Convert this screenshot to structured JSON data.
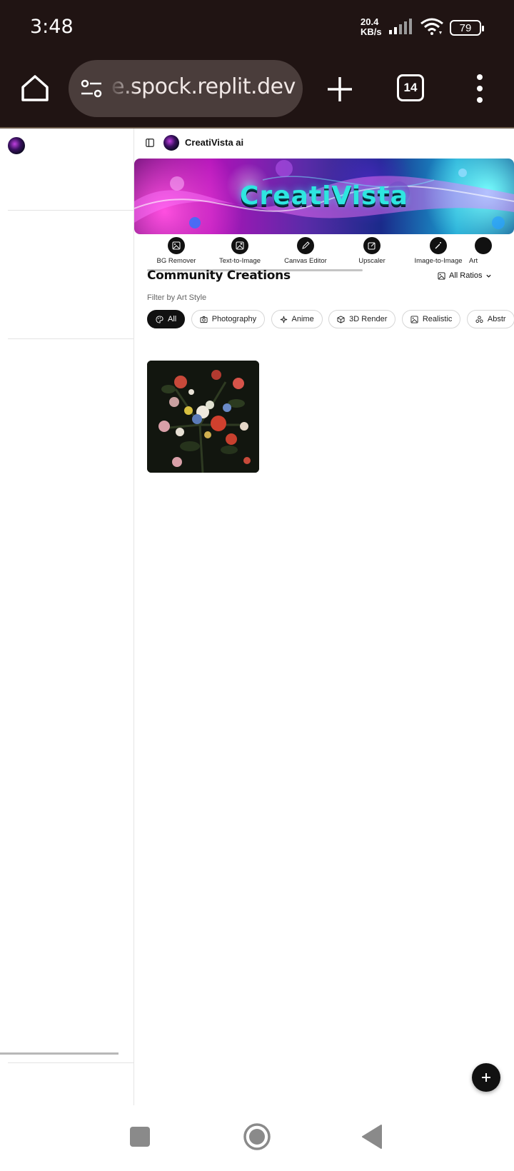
{
  "status_bar": {
    "time": "3:48",
    "net_speed_value": "20.4",
    "net_speed_unit": "KB/s",
    "battery": "79"
  },
  "browser": {
    "url": "e.spock.replit.dev",
    "tab_count": "14"
  },
  "app": {
    "brand_name": "CreatiVista ai",
    "banner_title": "CreatiVista"
  },
  "tools": [
    {
      "label": "BG Remover",
      "icon": "image-icon"
    },
    {
      "label": "Text-to-Image",
      "icon": "image-plus-icon"
    },
    {
      "label": "Canvas Editor",
      "icon": "pencil-icon"
    },
    {
      "label": "Upscaler",
      "icon": "edit-square-icon"
    },
    {
      "label": "Image-to-Image",
      "icon": "wand-icon"
    },
    {
      "label": "Art",
      "icon": "brush-icon"
    }
  ],
  "community": {
    "title": "Community Creations",
    "ratio_filter": "All Ratios",
    "filter_label": "Filter by Art Style",
    "styles": [
      {
        "label": "All",
        "icon": "palette-icon",
        "active": true
      },
      {
        "label": "Photography",
        "icon": "camera-icon"
      },
      {
        "label": "Anime",
        "icon": "sparkles-icon"
      },
      {
        "label": "3D Render",
        "icon": "cube-icon"
      },
      {
        "label": "Realistic",
        "icon": "image-icon"
      },
      {
        "label": "Abstr",
        "icon": "shapes-icon"
      }
    ]
  },
  "colors": {
    "browser_chrome": "#201413",
    "url_bar": "#4a3d3b",
    "accent_dark": "#111111"
  }
}
